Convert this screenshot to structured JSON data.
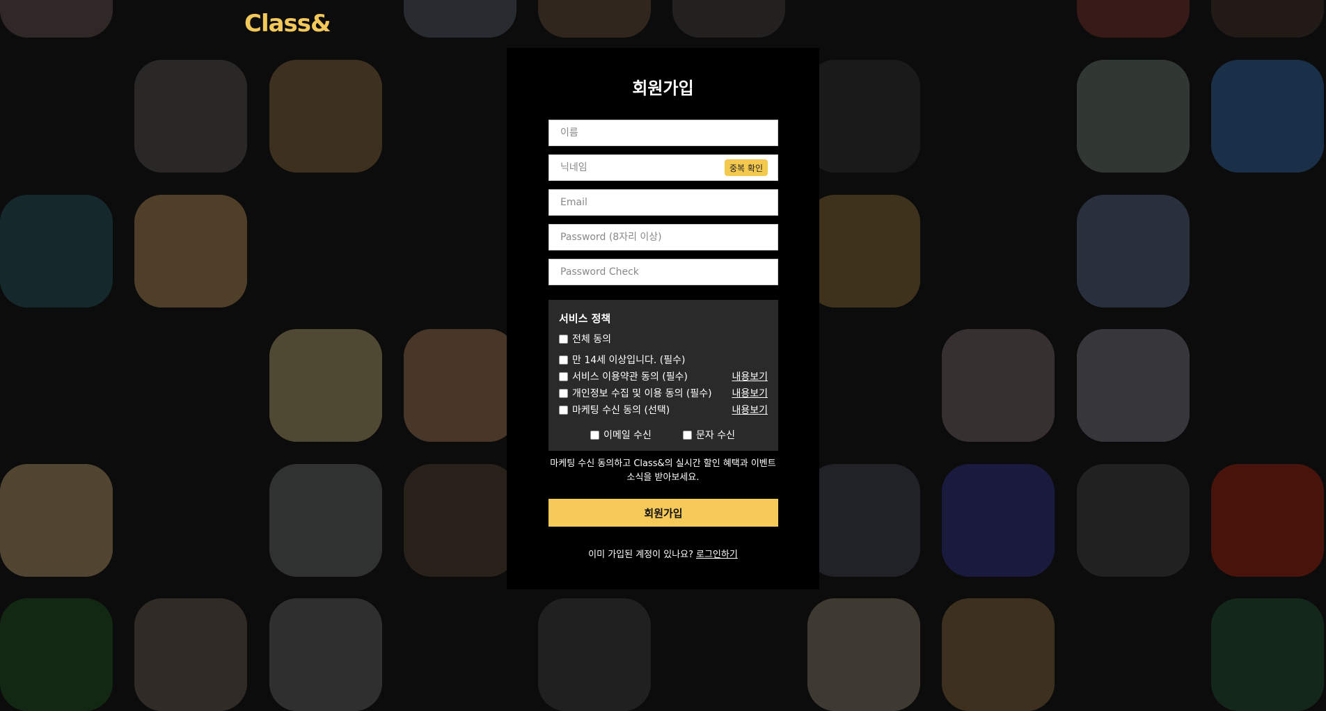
{
  "brand": {
    "logo": "Class&",
    "accent": "#f6c95b"
  },
  "signup": {
    "title": "회원가입",
    "fields": {
      "name_placeholder": "이름",
      "nickname_placeholder": "닉네임",
      "dup_check_label": "중복 확인",
      "email_placeholder": "Email",
      "password_placeholder": "Password (8자리 이상)",
      "password_check_placeholder": "Password Check"
    },
    "policy": {
      "title": "서비스 정책",
      "all_agree": "전체 동의",
      "items": [
        {
          "label": "만 14세 이상입니다. (필수)",
          "link": ""
        },
        {
          "label": "서비스 이용약관 동의 (필수)",
          "link": "내용보기"
        },
        {
          "label": "개인정보 수집 및 이용 동의 (필수)",
          "link": "내용보기"
        },
        {
          "label": "마케팅 수신 동의 (선택)",
          "link": "내용보기"
        }
      ],
      "email_receive": "이메일 수신",
      "sms_receive": "문자 수신"
    },
    "promo_line1": "마케팅 수신 동의하고 Class&의 실시간 할인 혜택과 이벤트",
    "promo_line2": "소식을 받아보세요.",
    "submit_label": "회원가입",
    "login_prompt": "이미 가입된 계정이 있나요?",
    "login_link": "로그인하기"
  },
  "background_tiles": [
    {
      "name": "fashion-tile",
      "color": "#6b5a54"
    },
    {
      "name": "laptop-tile",
      "color": "#5a5f6a"
    },
    {
      "name": "craft-tile",
      "color": "#6a5543"
    },
    {
      "name": "dance-tile",
      "color": "#4f4a48"
    },
    {
      "name": "flowers-tile",
      "color": "#7a3a34"
    },
    {
      "name": "street-tile",
      "color": "#5c5a56"
    },
    {
      "name": "cake-tile",
      "color": "#8a6a44"
    },
    {
      "name": "isometric-tile",
      "color": "#3a3a3a"
    },
    {
      "name": "chef-tile",
      "color": "#6e7a70"
    },
    {
      "name": "abstract-tile",
      "color": "#3a6aa0"
    },
    {
      "name": "cube-tile",
      "color": "#2f5a62"
    },
    {
      "name": "cheesecake-tile",
      "color": "#b08c5c"
    },
    {
      "name": "snack-tile",
      "color": "#8a7040"
    },
    {
      "name": "guitar-tile",
      "color": "#5a6a8a"
    },
    {
      "name": "pumpkin-tile",
      "color": "#b0a070"
    },
    {
      "name": "bread-tile",
      "color": "#a07a5a"
    },
    {
      "name": "collage-tile",
      "color": "#7a6a6a"
    },
    {
      "name": "model-tile",
      "color": "#7a7a84"
    },
    {
      "name": "pattern-tile",
      "color": "#b49a70"
    },
    {
      "name": "portrait-tile",
      "color": "#6a7070"
    },
    {
      "name": "coffee-tile",
      "color": "#5a4a3a"
    },
    {
      "name": "robot-tile",
      "color": "#4a4a5a"
    },
    {
      "name": "dance-studio-tile",
      "color": "#3a3a8a"
    },
    {
      "name": "group-tile",
      "color": "#4a4a4a"
    },
    {
      "name": "cocktail-tile",
      "color": "#a02a1a"
    },
    {
      "name": "knit-tile",
      "color": "#2a5a2a"
    },
    {
      "name": "woman-tile",
      "color": "#6a6058"
    },
    {
      "name": "yarn-tile",
      "color": "#6a6868"
    },
    {
      "name": "speaker-tile",
      "color": "#4a4848"
    },
    {
      "name": "plate-tile",
      "color": "#8a8070"
    },
    {
      "name": "dessert-tile",
      "color": "#8a6a44"
    },
    {
      "name": "board-tile",
      "color": "#2a5a3a"
    }
  ]
}
